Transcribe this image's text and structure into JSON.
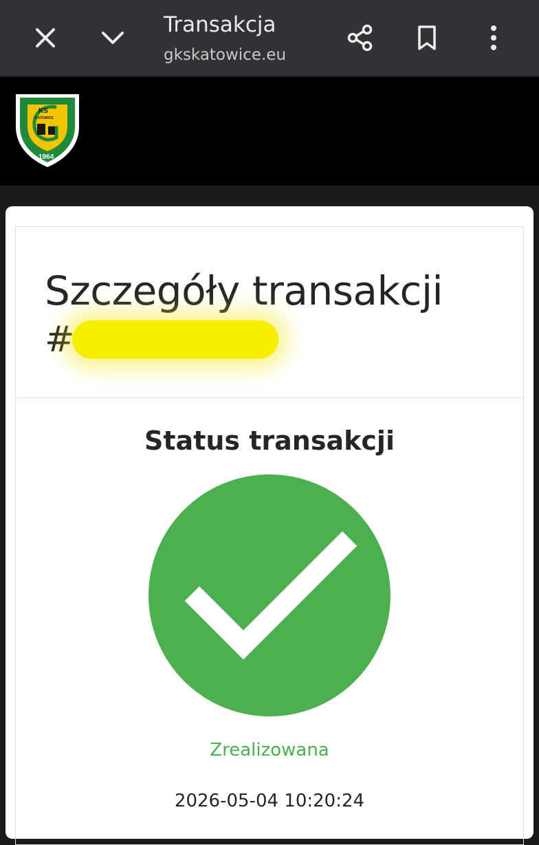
{
  "toolbar": {
    "title": "Transakcja",
    "url": "gkskatowice.eu",
    "icons": {
      "close": "close-icon",
      "minimize": "chevron-down-icon",
      "share": "share-icon",
      "bookmark": "bookmark-icon",
      "more": "more-vert-icon"
    },
    "background": "#313235"
  },
  "site_header": {
    "logo": {
      "top_text": "KS",
      "sub_text": "KATOWICE",
      "year": "1964",
      "colors": {
        "green": "#1f8a3c",
        "yellow": "#f3c500",
        "white": "#ffffff"
      }
    },
    "background": "#000000"
  },
  "transaction": {
    "details_title": "Szczegóły transakcji",
    "hash_prefix": "#",
    "redaction_color": "#f7ee00",
    "status_title": "Status transakcji",
    "status_icon": "check-circle-icon",
    "status_color": "#4caf50",
    "status_text": "Zrealizowana",
    "status_date": "2026-05-04 10:20:24"
  }
}
